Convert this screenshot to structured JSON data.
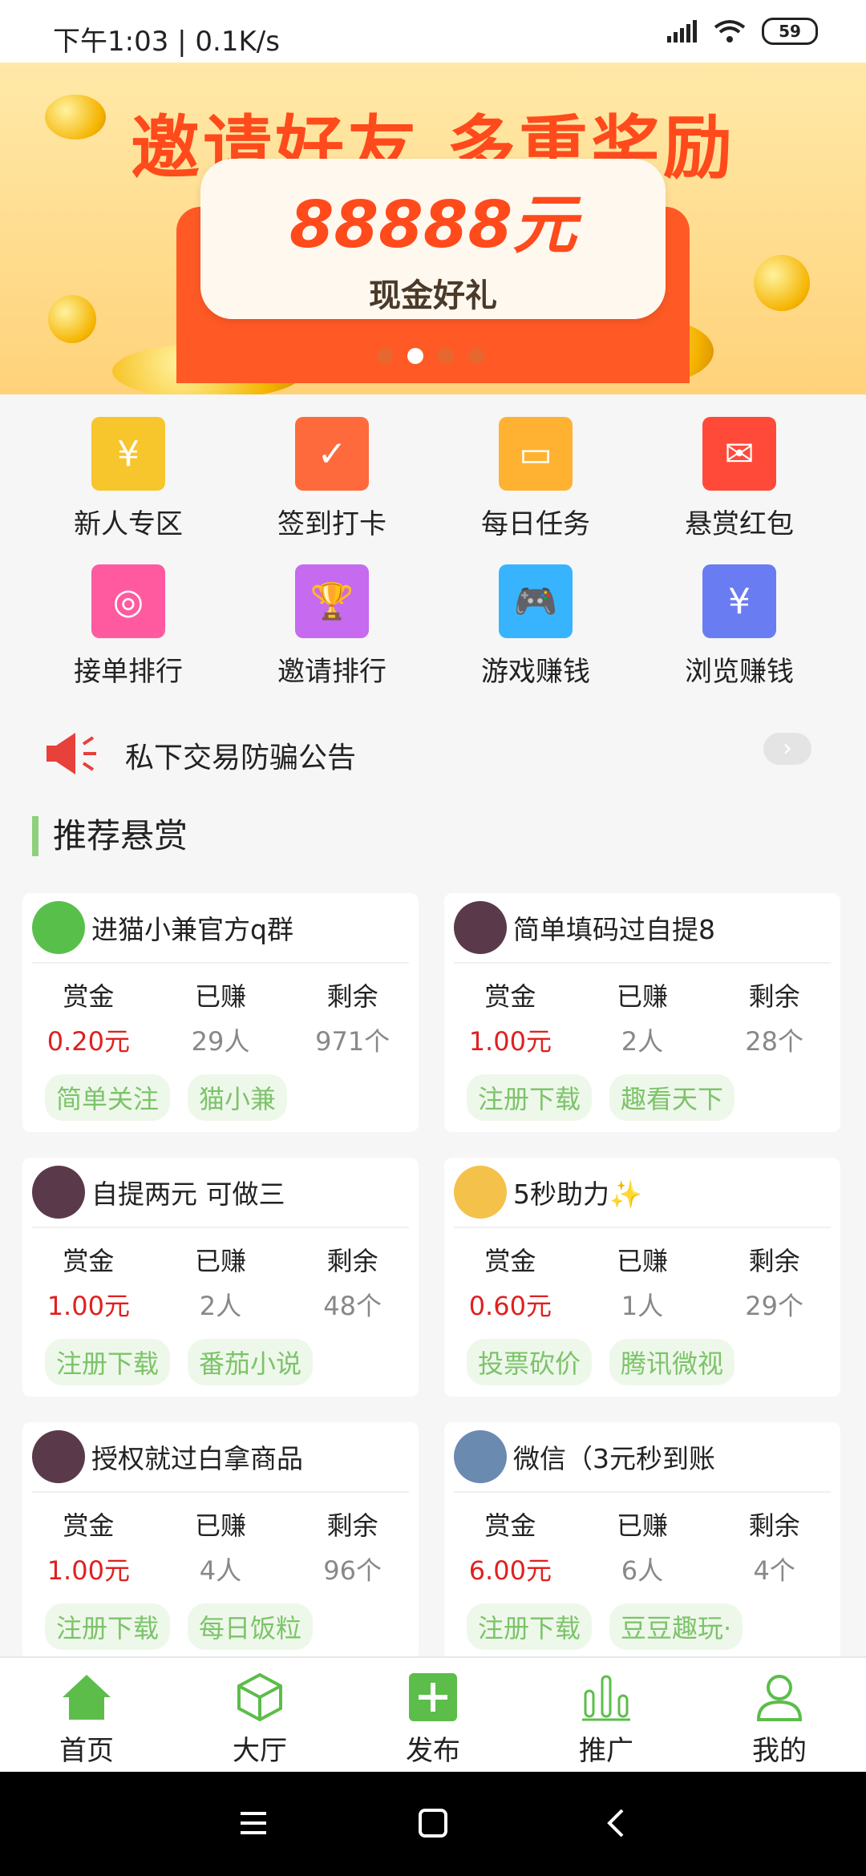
{
  "status": {
    "left_text": "下午1:03 | 0.1K/s",
    "battery": "59"
  },
  "banner": {
    "title": "邀请好友 多重奖励",
    "amount": "88888元",
    "subtitle": "现金好礼"
  },
  "grid": [
    {
      "label": "新人专区",
      "color": "#f7c52c",
      "glyph": "¥"
    },
    {
      "label": "签到打卡",
      "color": "#ff6a3d",
      "glyph": "✓"
    },
    {
      "label": "每日任务",
      "color": "#ffb232",
      "glyph": "▭"
    },
    {
      "label": "悬赏红包",
      "color": "#ff4a3a",
      "glyph": "✉"
    },
    {
      "label": "接单排行",
      "color": "#ff5aa0",
      "glyph": "◎"
    },
    {
      "label": "邀请排行",
      "color": "#c66af0",
      "glyph": "🏆"
    },
    {
      "label": "游戏赚钱",
      "color": "#38b4ff",
      "glyph": "🎮"
    },
    {
      "label": "浏览赚钱",
      "color": "#6a7cf2",
      "glyph": "¥"
    }
  ],
  "notice": {
    "text": "私下交易防骗公告",
    "more": "›"
  },
  "section_title": "推荐悬赏",
  "labels": {
    "reward": "赏金",
    "earned": "已赚",
    "remaining": "剩余"
  },
  "tasks": [
    {
      "name": "进猫小兼官方q群",
      "reward": "0.20元",
      "earned": "29人",
      "remaining": "971个",
      "tags": [
        "简单关注",
        "猫小兼"
      ],
      "avatar_color": "#58c04a"
    },
    {
      "name": "简单填码过自提8",
      "reward": "1.00元",
      "earned": "2人",
      "remaining": "28个",
      "tags": [
        "注册下载",
        "趣看天下"
      ],
      "avatar_color": "#5a3a4a"
    },
    {
      "name": "自提两元 可做三",
      "reward": "1.00元",
      "earned": "2人",
      "remaining": "48个",
      "tags": [
        "注册下载",
        "番茄小说"
      ],
      "avatar_color": "#5a3a4a"
    },
    {
      "name": "5秒助力✨",
      "reward": "0.60元",
      "earned": "1人",
      "remaining": "29个",
      "tags": [
        "投票砍价",
        "腾讯微视"
      ],
      "avatar_color": "#f4c24a"
    },
    {
      "name": "授权就过白拿商品",
      "reward": "1.00元",
      "earned": "4人",
      "remaining": "96个",
      "tags": [
        "注册下载",
        "每日饭粒"
      ],
      "avatar_color": "#5a3a4a"
    },
    {
      "name": "微信（3元秒到账",
      "reward": "6.00元",
      "earned": "6人",
      "remaining": "4个",
      "tags": [
        "注册下载",
        "豆豆趣玩·"
      ],
      "avatar_color": "#6a8ab0"
    }
  ],
  "bottom_nav": [
    {
      "label": "首页",
      "icon": "home-icon"
    },
    {
      "label": "大厅",
      "icon": "cube-icon"
    },
    {
      "label": "发布",
      "icon": "plus-icon"
    },
    {
      "label": "推广",
      "icon": "bars-icon"
    },
    {
      "label": "我的",
      "icon": "user-icon"
    }
  ],
  "colors": {
    "accent": "#5cbd4a",
    "price": "#e02020",
    "tag": "#7cc36a"
  }
}
